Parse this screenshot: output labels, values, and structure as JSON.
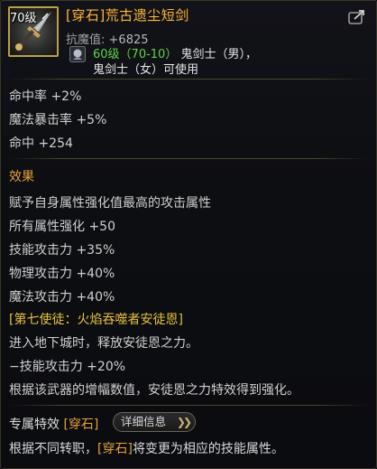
{
  "header": {
    "level_badge": "70级",
    "item_name": "[穿石]荒古遗尘短剑",
    "attack_label": "抗魔值:",
    "attack_value": "+6825",
    "req_level": "60级（70-10）",
    "req_class_1": "鬼剑士（男），",
    "req_class_2": "鬼剑士（女）可使用",
    "item_icon": "sword-icon",
    "share_icon": "share-arrow-icon",
    "job_icon": "job-class-icon"
  },
  "stats": {
    "hit_rate": "命中率 +2%",
    "magic_crit": "魔法暴击率 +5%",
    "hit": "命中 +254"
  },
  "effect": {
    "title": "效果",
    "lines": [
      "赋予自身属性强化值最高的攻击属性",
      "所有属性强化 +50",
      "技能攻击力 +35%",
      "物理攻击力 +40%",
      "魔法攻击力 +40%"
    ]
  },
  "set_effect": {
    "name": "[第七使徒：火焰吞噬者安徒恩]",
    "lines": [
      "进入地下城时，释放安徒恩之力。",
      "−技能攻击力 +20%",
      "根据该武器的增幅数值，安徒恩之力特效得到强化。"
    ]
  },
  "footer": {
    "title": "专属特效",
    "tag": "[穿石]",
    "detail_button": "详细信息",
    "text_prefix": "根据不同转职，",
    "text_tag": "[穿石]",
    "text_suffix": "将变更为相应的技能属性。"
  },
  "colors": {
    "item_name": "#ffb73a",
    "req_level": "#5fd34d",
    "section_title": "#e5a23b",
    "set_name": "#e7c23b",
    "border": "#3a3526"
  }
}
